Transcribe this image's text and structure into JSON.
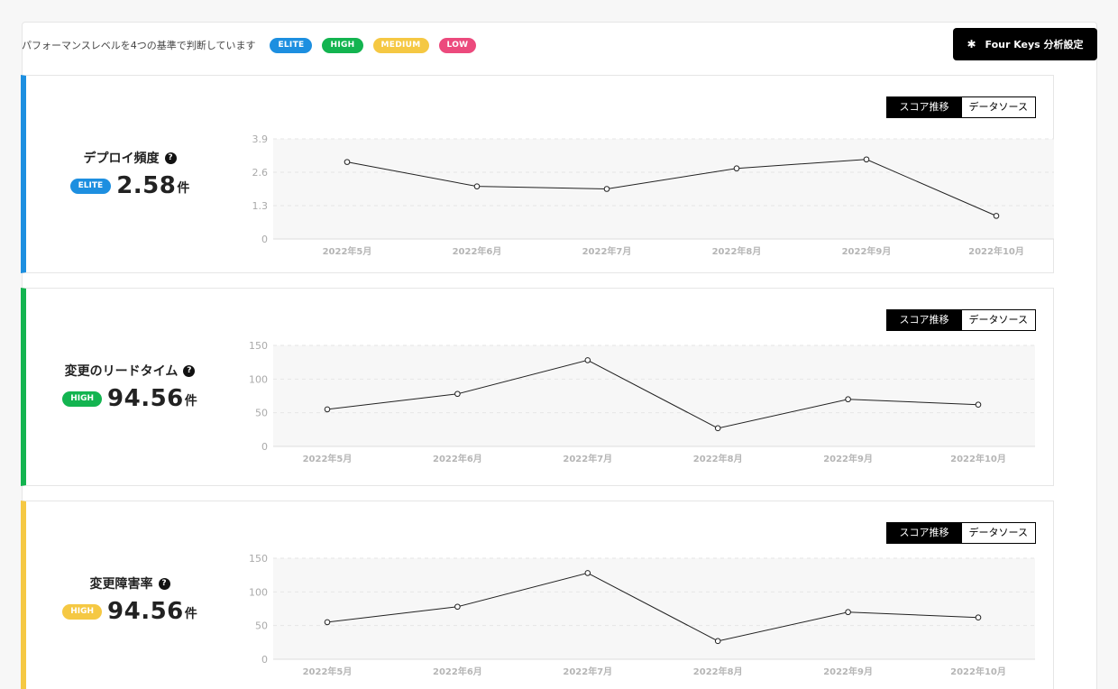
{
  "header": {
    "description": "パフォーマンスレベルを4つの基準で判断しています",
    "levels": [
      "ELITE",
      "HIGH",
      "MEDIUM",
      "LOW"
    ],
    "settings_label": "Four Keys 分析設定"
  },
  "colors": {
    "elite": "#1d8fe0",
    "high": "#13b450",
    "medium": "#f5c843",
    "low": "#ec4a7d"
  },
  "toggle": {
    "active": "スコア推移",
    "inactive": "データソース"
  },
  "cards": [
    {
      "name": "デプロイ頻度",
      "badge": "ELITE",
      "value": "2.58",
      "unit": "件"
    },
    {
      "name": "変更のリードタイム",
      "badge": "HIGH",
      "value": "94.56",
      "unit": "件"
    },
    {
      "name": "変更障害率",
      "badge": "HIGH",
      "value": "94.56",
      "unit": "件"
    }
  ],
  "chart_data": [
    {
      "type": "line",
      "x": [
        "2022年5月",
        "2022年6月",
        "2022年7月",
        "2022年8月",
        "2022年9月",
        "2022年10月"
      ],
      "values": [
        3.0,
        2.05,
        1.95,
        2.75,
        3.1,
        0.9
      ],
      "ylim": [
        0,
        3.9
      ],
      "yticks": [
        "0",
        "1.3",
        "2.6",
        "3.9"
      ]
    },
    {
      "type": "line",
      "x": [
        "2022年5月",
        "2022年6月",
        "2022年7月",
        "2022年8月",
        "2022年9月",
        "2022年10月"
      ],
      "values": [
        55,
        78,
        128,
        27,
        70,
        62
      ],
      "ylim": [
        0,
        150
      ],
      "yticks": [
        "0",
        "50",
        "100",
        "150"
      ]
    },
    {
      "type": "line",
      "x": [
        "2022年5月",
        "2022年6月",
        "2022年7月",
        "2022年8月",
        "2022年9月",
        "2022年10月"
      ],
      "values": [
        55,
        78,
        128,
        27,
        70,
        62
      ],
      "ylim": [
        0,
        150
      ],
      "yticks": [
        "0",
        "50",
        "100",
        "150"
      ]
    }
  ]
}
